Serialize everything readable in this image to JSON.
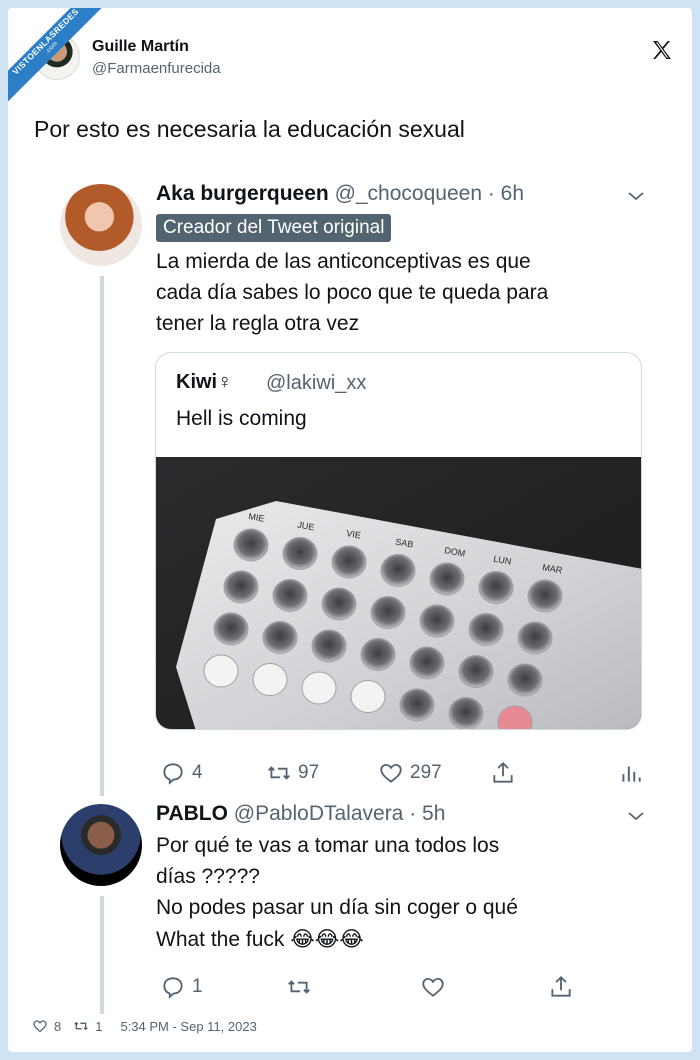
{
  "watermark": {
    "text": "VISTOENLASREDES",
    "sub": ".com"
  },
  "author": {
    "name": "Guille Martín",
    "handle": "@Farmaenfurecida"
  },
  "tweet_text": "Por esto es necesaria la educación sexual",
  "reply1": {
    "name": "Aka burgerqueen",
    "meta": "@_chocoqueen · 6h",
    "badge": "Creador del Tweet original",
    "lines": [
      "La mierda de las anticonceptivas es que",
      "cada día sabes lo poco que te queda para",
      "tener la regla otra vez"
    ],
    "quote": {
      "name": "Kiwi♀",
      "handle": "@lakiwi_xx",
      "text": "Hell is coming",
      "photo_days": [
        "MIE",
        "JUE",
        "VIE",
        "SAB",
        "DOM",
        "LUN",
        "MAR"
      ]
    },
    "actions": {
      "replies": "4",
      "retweets": "97",
      "likes": "297"
    }
  },
  "reply2": {
    "name": "PABLO",
    "meta": "@PabloDTalavera · 5h",
    "lines": [
      "Por qué te vas a tomar una todos los",
      "días ?????",
      "No podes pasar un día sin coger o qué",
      "What the fuck 😂😂😂"
    ],
    "actions": {
      "replies": "1"
    }
  },
  "footer": {
    "likes": "8",
    "retweets": "1",
    "timestamp": "5:34 PM - Sep 11, 2023"
  },
  "colors": {
    "text": "#0f1419",
    "muted": "#536471",
    "border": "#cfd9de",
    "badge": "#536471",
    "ribbon": "#2c7fc6",
    "frame_bg": "#cfe3f3"
  },
  "icons": [
    "x-logo-icon",
    "chevron-down-icon",
    "reply-icon",
    "retweet-icon",
    "like-icon",
    "share-icon",
    "analytics-icon"
  ]
}
